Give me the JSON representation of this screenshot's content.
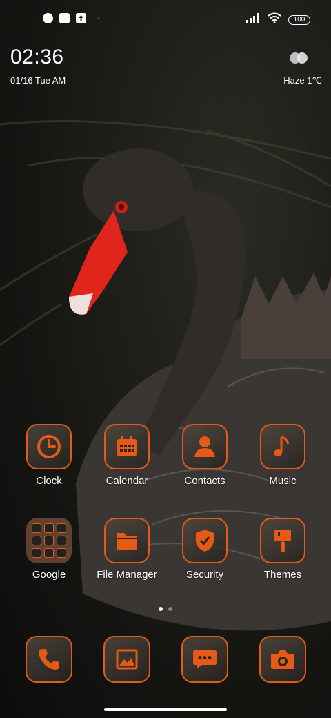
{
  "status_bar": {
    "battery": "100",
    "notification_icons": [
      "notification-icon",
      "square-icon",
      "upload-icon"
    ],
    "more": "··"
  },
  "clock_widget": {
    "time": "02:36",
    "date": "01/16 Tue AM",
    "weather": "Haze 1℃"
  },
  "apps": [
    {
      "label": "Clock",
      "icon": "clock-icon"
    },
    {
      "label": "Calendar",
      "icon": "calendar-icon"
    },
    {
      "label": "Contacts",
      "icon": "contact-icon"
    },
    {
      "label": "Music",
      "icon": "music-note-icon"
    },
    {
      "label": "Google",
      "icon": "folder-icon"
    },
    {
      "label": "File Manager",
      "icon": "folder-icon"
    },
    {
      "label": "Security",
      "icon": "shield-icon"
    },
    {
      "label": "Themes",
      "icon": "paint-brush-icon"
    }
  ],
  "dock": [
    {
      "icon": "phone-icon"
    },
    {
      "icon": "gallery-icon"
    },
    {
      "icon": "message-icon"
    },
    {
      "icon": "camera-icon"
    }
  ],
  "pages": {
    "count": 2,
    "active": 1
  },
  "theme": {
    "accent": "#e55a16"
  }
}
